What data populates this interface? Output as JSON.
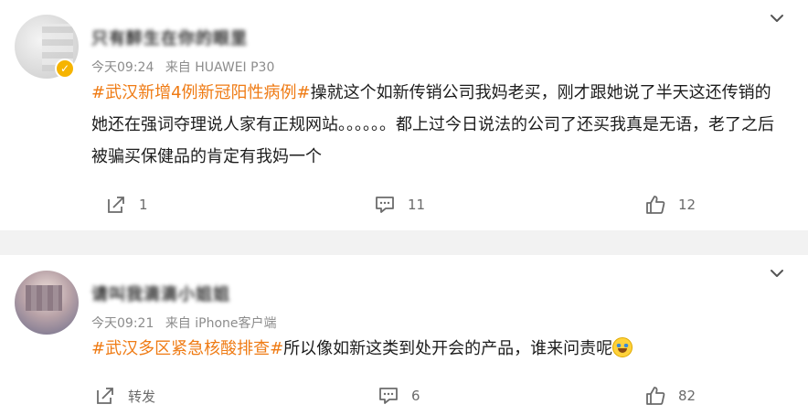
{
  "posts": [
    {
      "username": "只有醉生在你的眼里",
      "time": "今天09:24",
      "source": "来自 HUAWEI P30",
      "hashtag": "#武汉新增4例新冠阳性病例#",
      "text": "操就这个如新传销公司我妈老买，刚才跟她说了半天这还传销的她还在强词夺理说人家有正规网站。。。。。。都上过今日说法的公司了还买我真是无语，老了之后被骗买保健品的肯定有我妈一个",
      "share_label": "1",
      "comment_count": "11",
      "like_count": "12"
    },
    {
      "username": "请叫我滴滴小姐姐",
      "time": "今天09:21",
      "source": "来自 iPhone客户端",
      "hashtag": "#武汉多区紧急核酸排查#",
      "text": "所以像如新这类到处开会的产品，谁来问责呢",
      "share_label": "转发",
      "comment_count": "6",
      "like_count": "82"
    }
  ],
  "colors": {
    "hashtag": "#ef7b14",
    "meta": "#8c8c8c",
    "divider": "#f2f2f2",
    "verified": "#f6b400"
  },
  "icons": [
    "chevron-down-icon",
    "share-icon",
    "comment-icon",
    "like-icon",
    "verified-badge-icon",
    "crying-laughing-emoji"
  ]
}
